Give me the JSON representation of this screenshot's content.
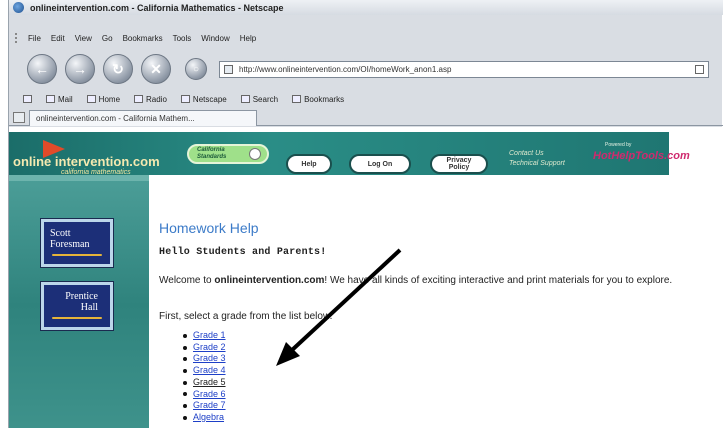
{
  "window": {
    "title": "onlineintervention.com - California Mathematics - Netscape"
  },
  "menu": {
    "items": [
      "File",
      "Edit",
      "View",
      "Go",
      "Bookmarks",
      "Tools",
      "Window",
      "Help"
    ]
  },
  "navigation": {
    "url": "http://www.onlineintervention.com/OI/homeWork_anon1.asp"
  },
  "personal_toolbar": {
    "items": [
      "Mail",
      "Home",
      "Radio",
      "Netscape",
      "Search",
      "Bookmarks"
    ]
  },
  "tabs": [
    {
      "label": "onlineintervention.com - California Mathem..."
    }
  ],
  "site": {
    "brand": "online intervention.com",
    "brand_sub": "california mathematics",
    "nav": {
      "california_standards": "California Standards",
      "help": "Help",
      "login": "Log On",
      "privacy": "Privacy Policy"
    },
    "contact": "Contact Us",
    "support": "Technical Support",
    "powered_by": "Powered by",
    "partner_logo": "HotHelpTools.com",
    "publishers": [
      {
        "name": "Scott Foresman"
      },
      {
        "name": "Prentice Hall"
      }
    ]
  },
  "content": {
    "title": "Homework Help",
    "greeting": "Hello Students and Parents!",
    "welcome_prefix": "Welcome to ",
    "welcome_site": "onlineintervention.com",
    "welcome_suffix": "! We have all kinds of exciting interactive and print materials for you to explore.",
    "instruction": "First, select a grade from the list below.",
    "grades": [
      "Grade 1",
      "Grade 2",
      "Grade 3",
      "Grade 4",
      "Grade 5",
      "Grade 6",
      "Grade 7",
      "Algebra"
    ]
  },
  "colors": {
    "site_teal": "#2a8d86",
    "title_blue": "#3c7bc8",
    "link_blue": "#1d3fc7"
  }
}
